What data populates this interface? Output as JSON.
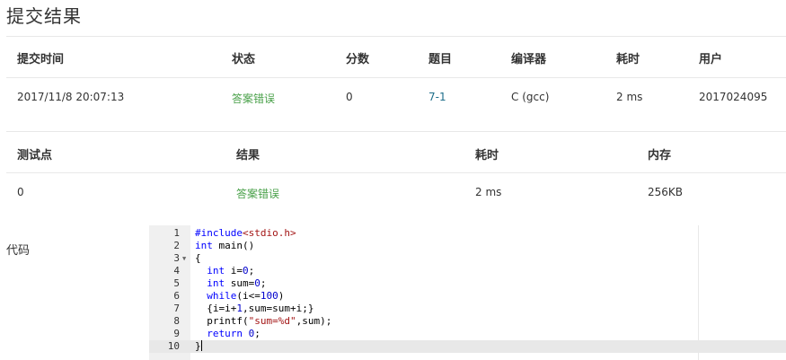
{
  "page": {
    "title": "提交结果"
  },
  "submission_table": {
    "headers": [
      "提交时间",
      "状态",
      "分数",
      "题目",
      "编译器",
      "耗时",
      "用户"
    ],
    "row": {
      "time": "2017/11/8 20:07:13",
      "status": "答案错误",
      "score": "0",
      "problem": "7-1",
      "compiler": "C (gcc)",
      "elapsed": "2 ms",
      "user": "2017024095"
    }
  },
  "testcase_table": {
    "headers": [
      "测试点",
      "结果",
      "耗时",
      "内存"
    ],
    "row": {
      "case": "0",
      "result": "答案错误",
      "elapsed": "2 ms",
      "memory": "256KB"
    }
  },
  "code": {
    "label": "代码",
    "active_line": 10,
    "lines": [
      {
        "n": "1",
        "text": "#include<stdio.h>"
      },
      {
        "n": "2",
        "text": "int main()"
      },
      {
        "n": "3",
        "text": "{"
      },
      {
        "n": "4",
        "text": "  int i=0;"
      },
      {
        "n": "5",
        "text": "  int sum=0;"
      },
      {
        "n": "6",
        "text": "  while(i<=100)"
      },
      {
        "n": "7",
        "text": "  {i=i+1,sum=sum+i;}"
      },
      {
        "n": "8",
        "text": "  printf(\"sum=%d\",sum);"
      },
      {
        "n": "9",
        "text": "  return 0;"
      },
      {
        "n": "10",
        "text": "}"
      }
    ]
  },
  "colors": {
    "status_error": "#4aa14a",
    "link": "#1f6f8b",
    "gutter": "#f0f0f0"
  }
}
